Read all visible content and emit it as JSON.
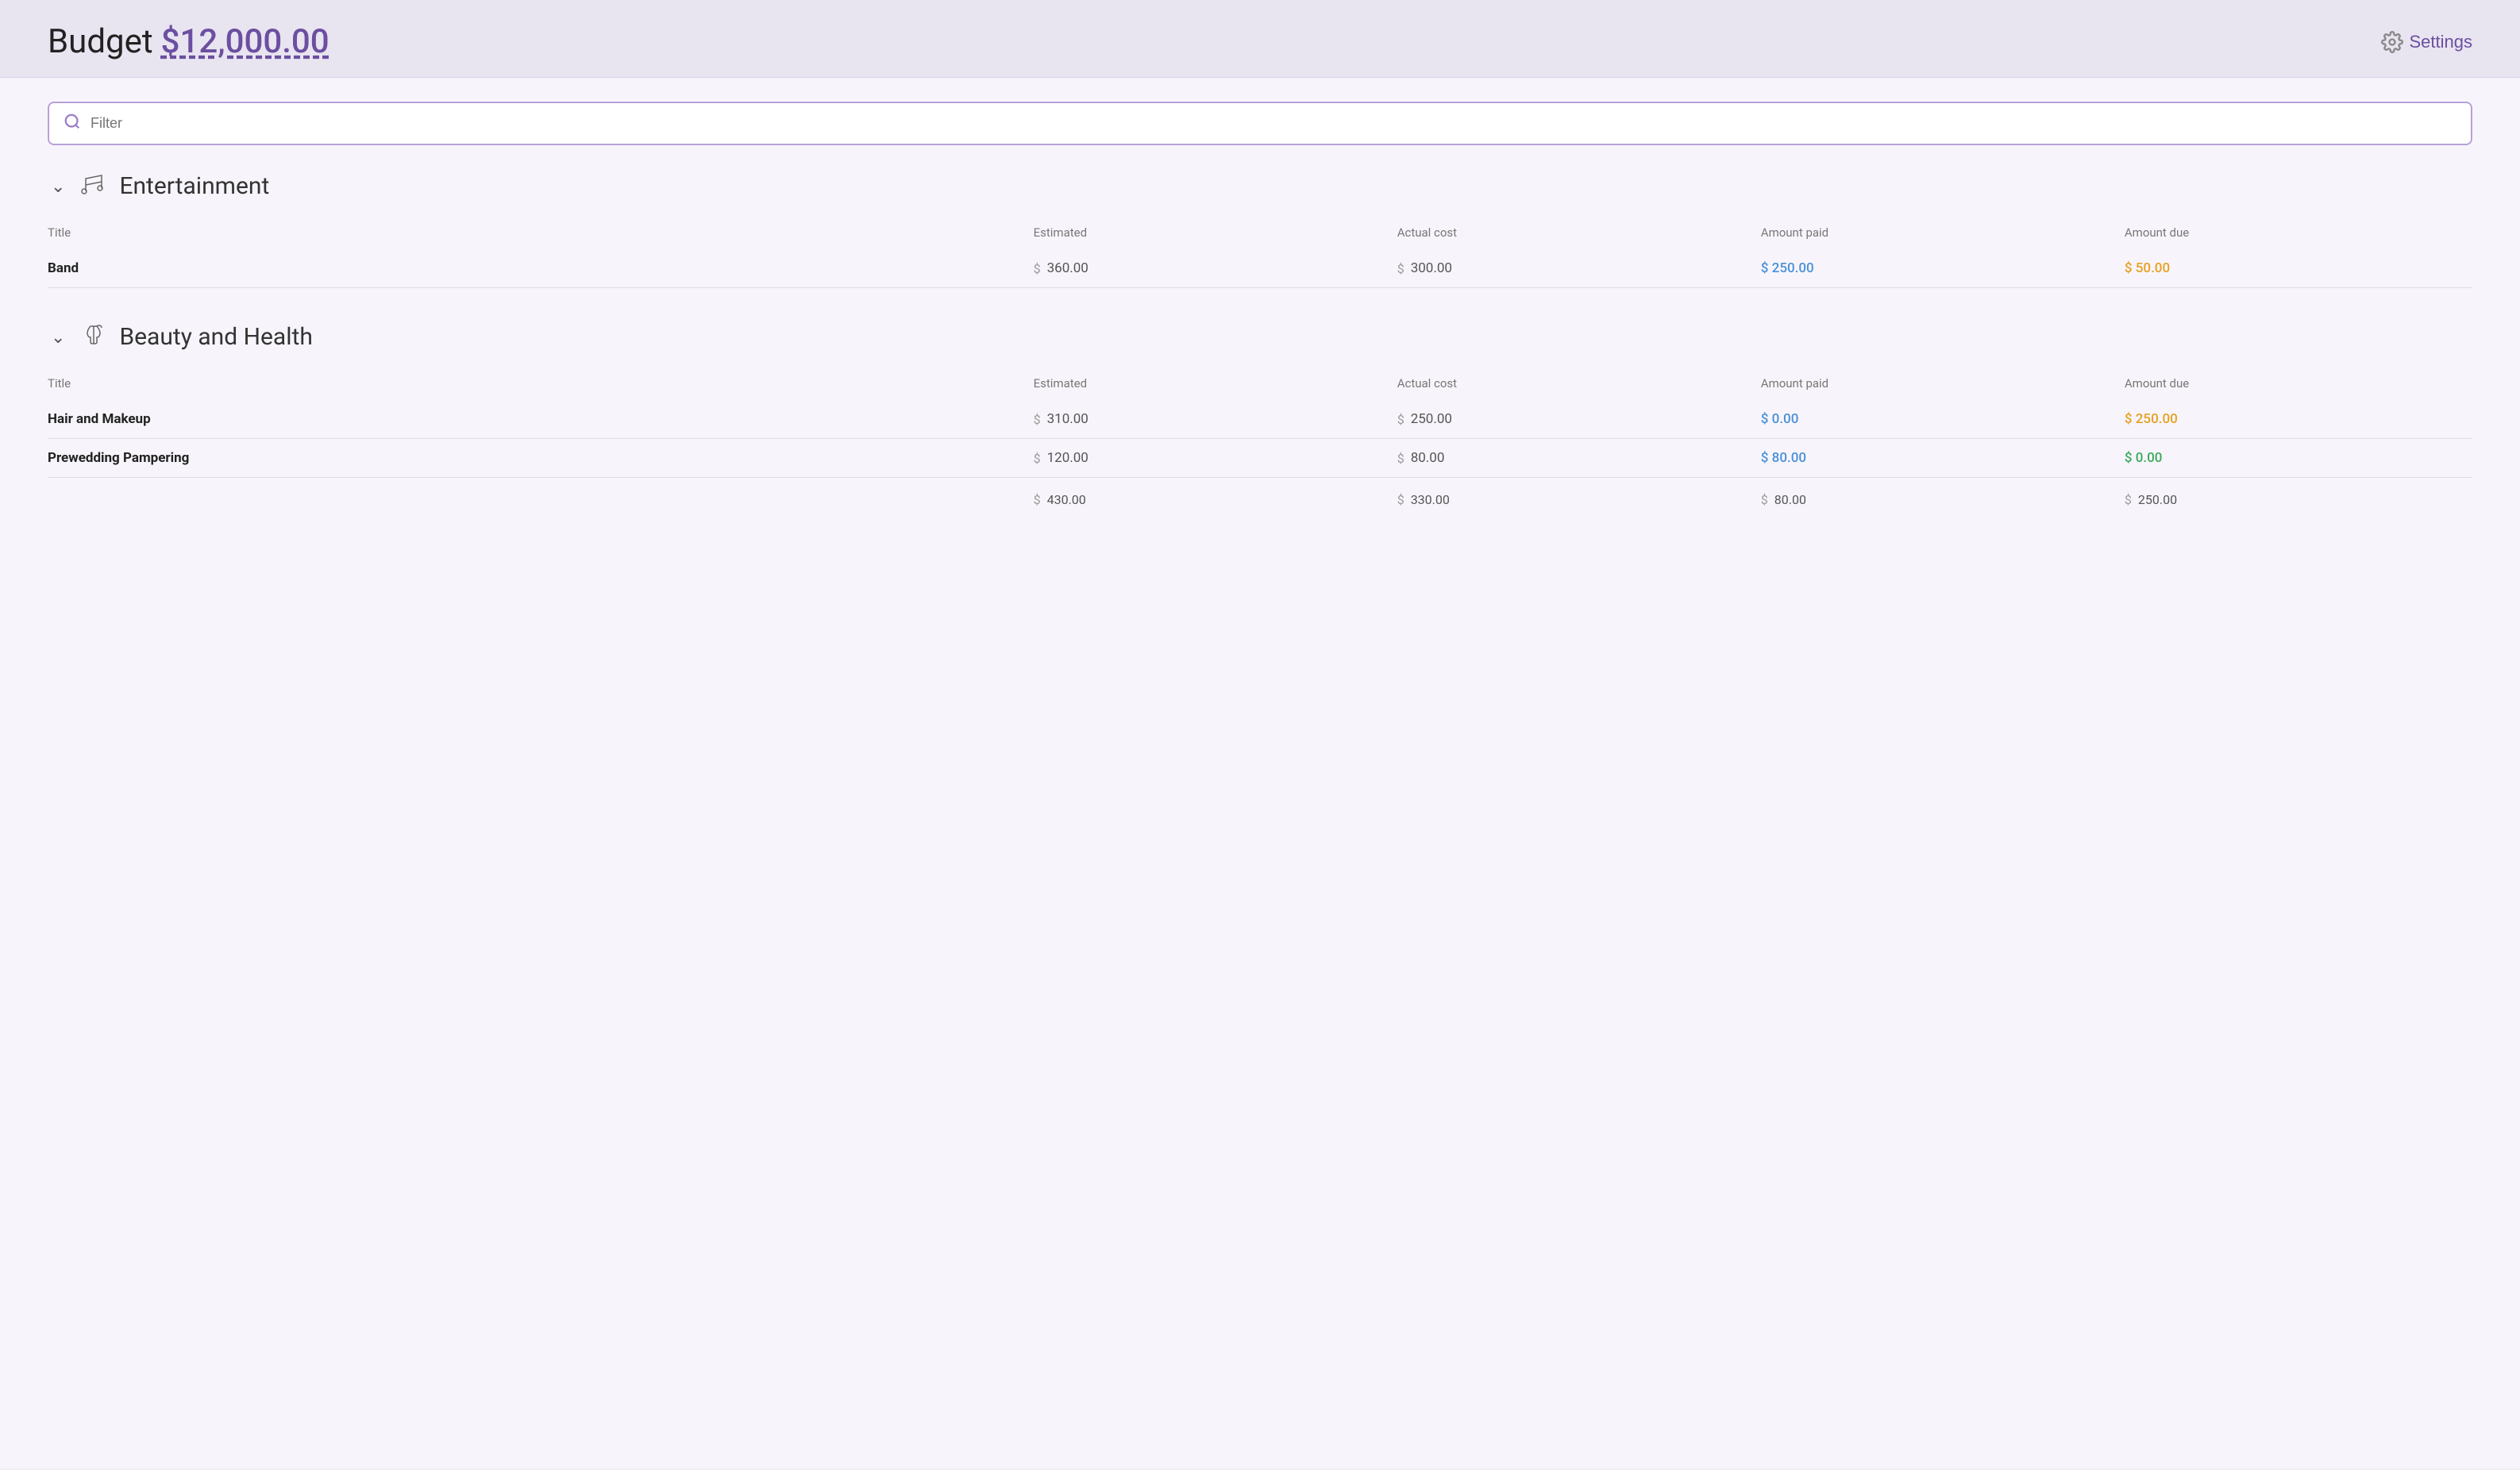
{
  "header": {
    "budget_label": "Budget",
    "budget_amount": "$12,000.00",
    "settings_label": "Settings"
  },
  "filter": {
    "placeholder": "Filter"
  },
  "sections": [
    {
      "id": "entertainment",
      "title": "Entertainment",
      "icon": "♩♫",
      "collapsed": false,
      "columns": {
        "title": "Title",
        "estimated": "Estimated",
        "actual_cost": "Actual cost",
        "amount_paid": "Amount paid",
        "amount_due": "Amount due"
      },
      "rows": [
        {
          "title": "Band",
          "estimated": "360.00",
          "actual_cost": "300.00",
          "amount_paid": "250.00",
          "amount_paid_color": "blue",
          "amount_due": "50.00",
          "amount_due_color": "orange"
        }
      ],
      "totals": null
    },
    {
      "id": "beauty-health",
      "title": "Beauty and Health",
      "icon": "💇",
      "collapsed": false,
      "columns": {
        "title": "Title",
        "estimated": "Estimated",
        "actual_cost": "Actual cost",
        "amount_paid": "Amount paid",
        "amount_due": "Amount due"
      },
      "rows": [
        {
          "title": "Hair and Makeup",
          "estimated": "310.00",
          "actual_cost": "250.00",
          "amount_paid": "0.00",
          "amount_paid_color": "blue",
          "amount_due": "250.00",
          "amount_due_color": "orange"
        },
        {
          "title": "Prewedding Pampering",
          "estimated": "120.00",
          "actual_cost": "80.00",
          "amount_paid": "80.00",
          "amount_paid_color": "blue",
          "amount_due": "0.00",
          "amount_due_color": "green"
        }
      ],
      "totals": {
        "estimated": "430.00",
        "actual_cost": "330.00",
        "amount_paid": "80.00",
        "amount_due": "250.00"
      }
    }
  ]
}
